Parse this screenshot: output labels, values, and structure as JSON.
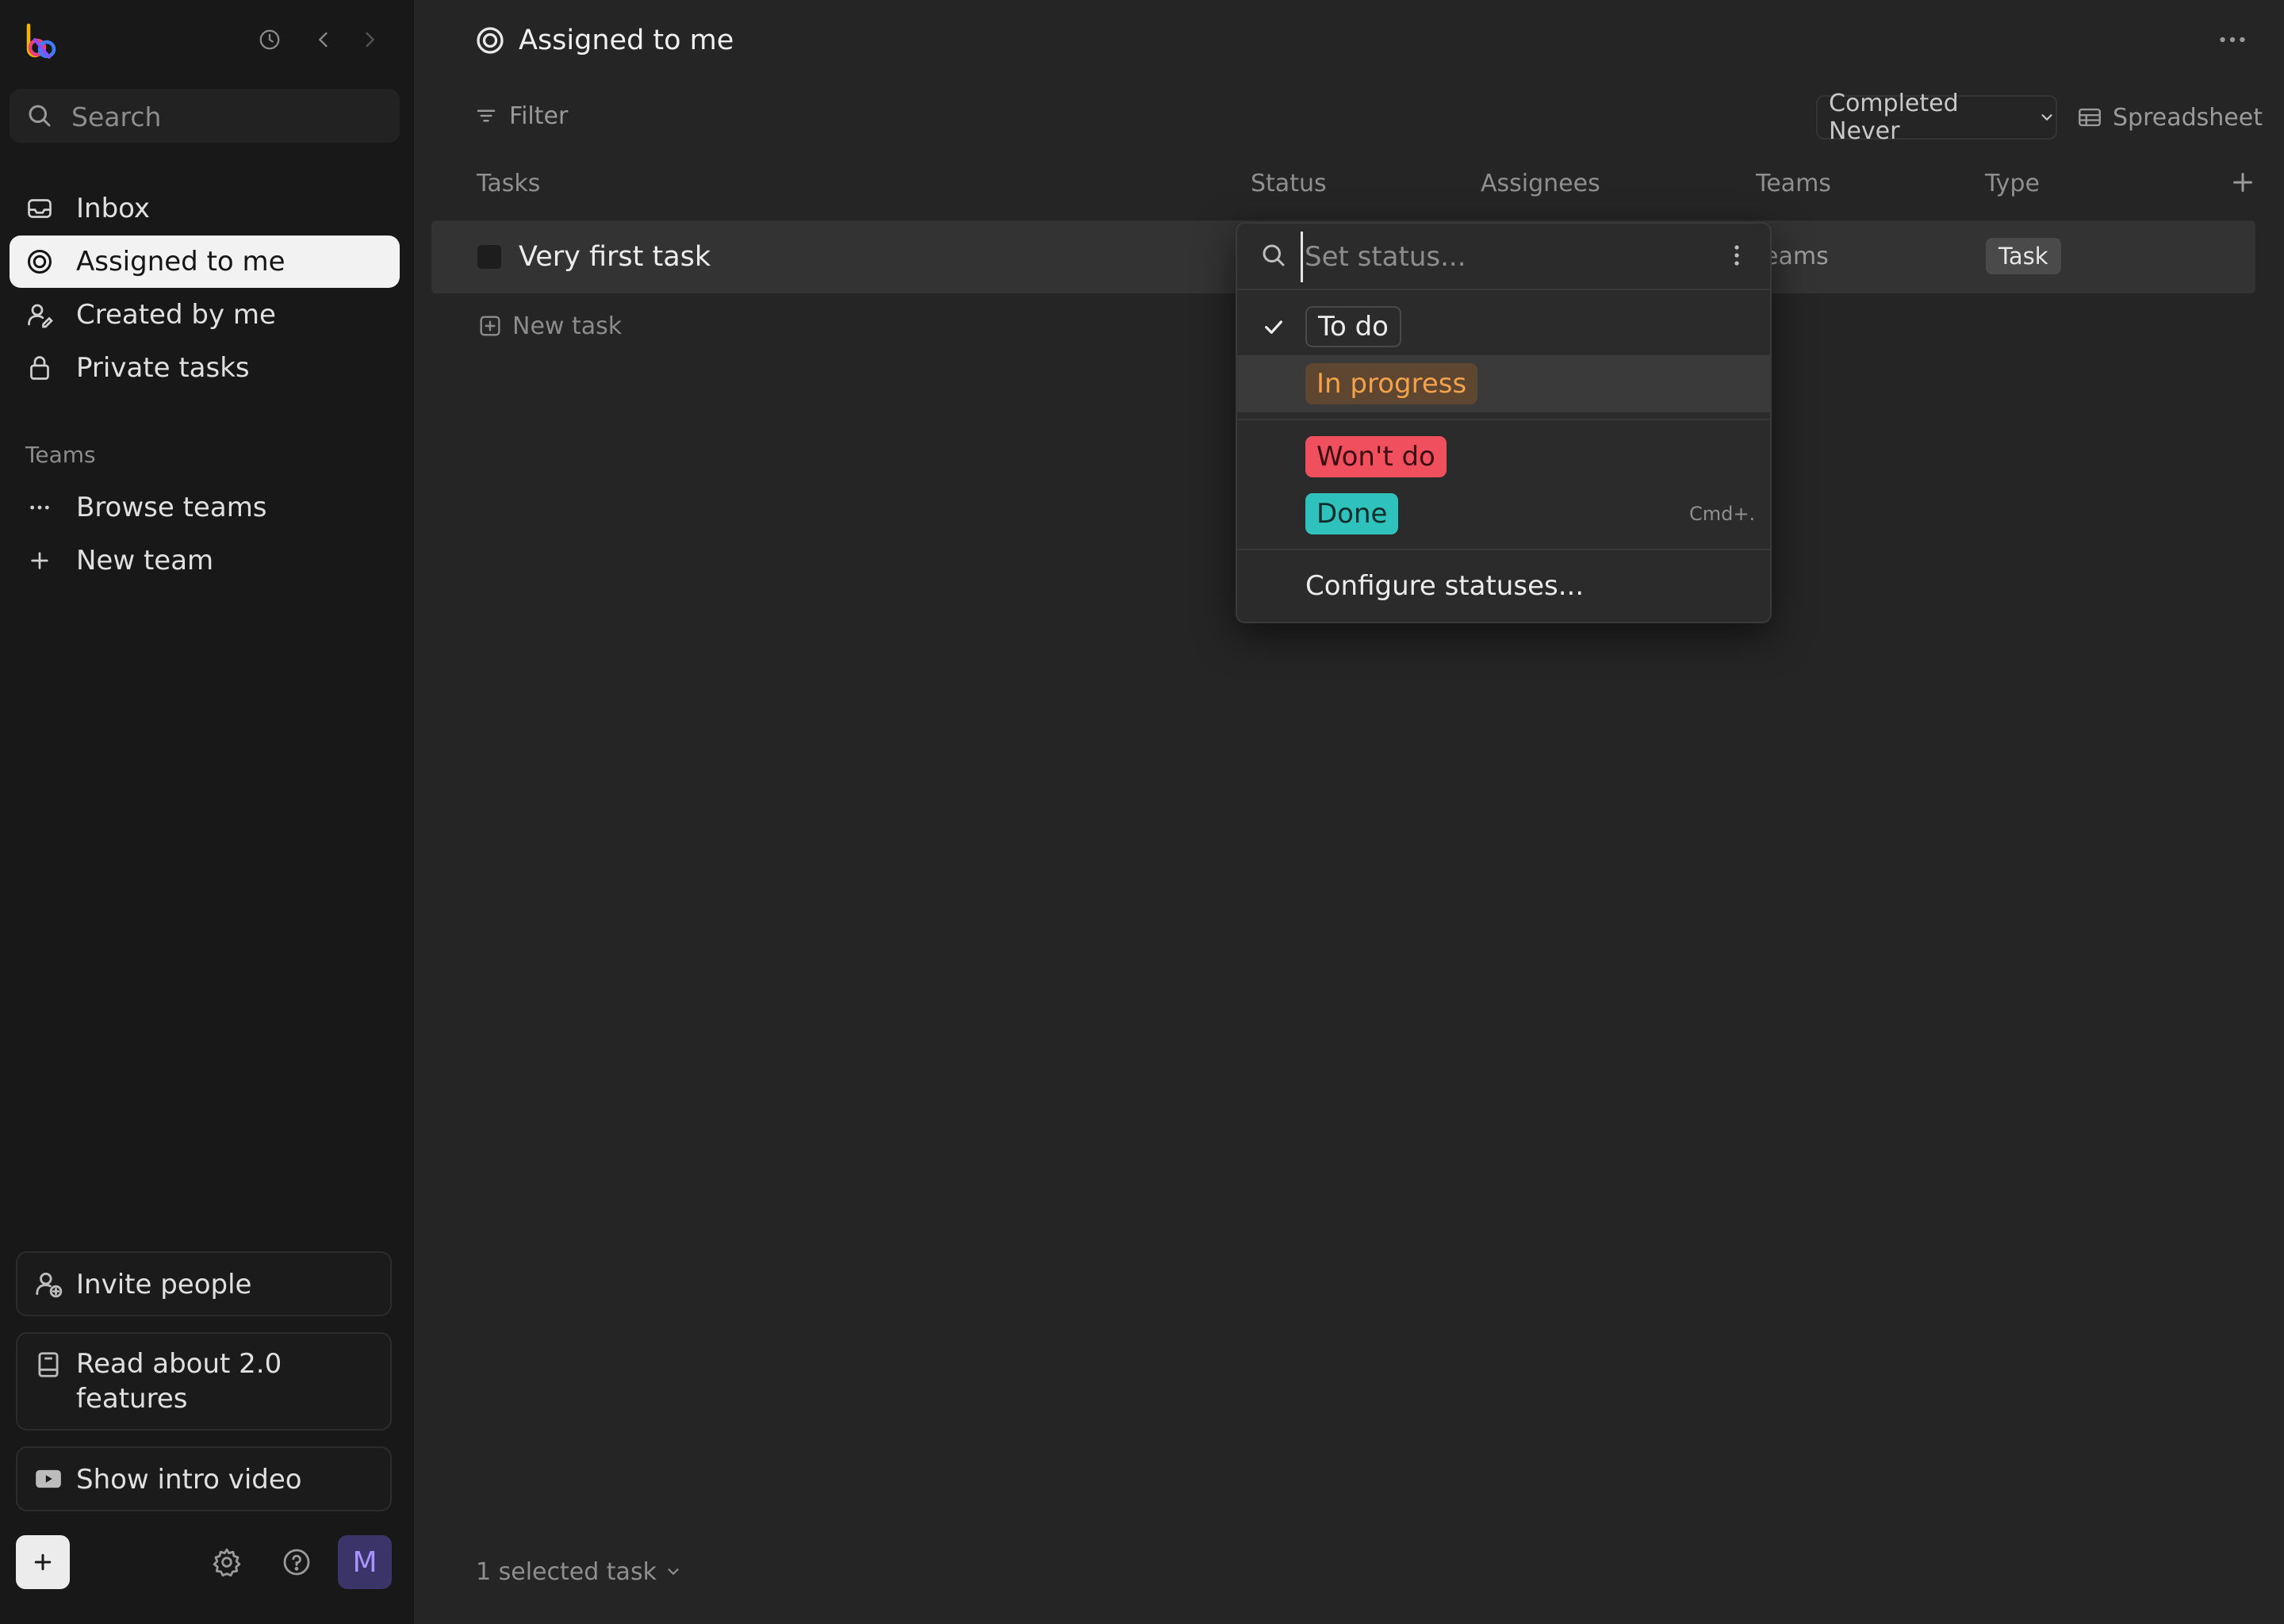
{
  "sidebar": {
    "search_placeholder": "Search",
    "nav": [
      {
        "label": "Inbox"
      },
      {
        "label": "Assigned to me"
      },
      {
        "label": "Created by me"
      },
      {
        "label": "Private tasks"
      }
    ],
    "teams_section_label": "Teams",
    "teams_items": [
      {
        "label": "Browse teams"
      },
      {
        "label": "New team"
      }
    ],
    "invite_label": "Invite people",
    "read_label": "Read about 2.0 features",
    "video_label": "Show intro video",
    "avatar_initial": "M"
  },
  "main": {
    "title": "Assigned to me",
    "filter_label": "Filter",
    "completed_label": "Completed Never",
    "view_label": "Spreadsheet",
    "columns": [
      "Tasks",
      "Status",
      "Assignees",
      "Teams",
      "Type"
    ],
    "tasks": [
      {
        "title": "Very first task",
        "teams": "eams",
        "type": "Task"
      }
    ],
    "new_task_label": "New task",
    "selected_label": "1 selected task"
  },
  "status_dropdown": {
    "placeholder": "Set status...",
    "options": [
      {
        "label": "To do"
      },
      {
        "label": "In progress"
      },
      {
        "label": "Won't do"
      },
      {
        "label": "Done",
        "shortcut": "Cmd+."
      }
    ],
    "configure_label": "Configure statuses..."
  },
  "colors": {
    "in_progress": "#f3a24a",
    "wont_do": "#f0505e",
    "done": "#2fc1bb",
    "avatar": "#a994ff"
  }
}
